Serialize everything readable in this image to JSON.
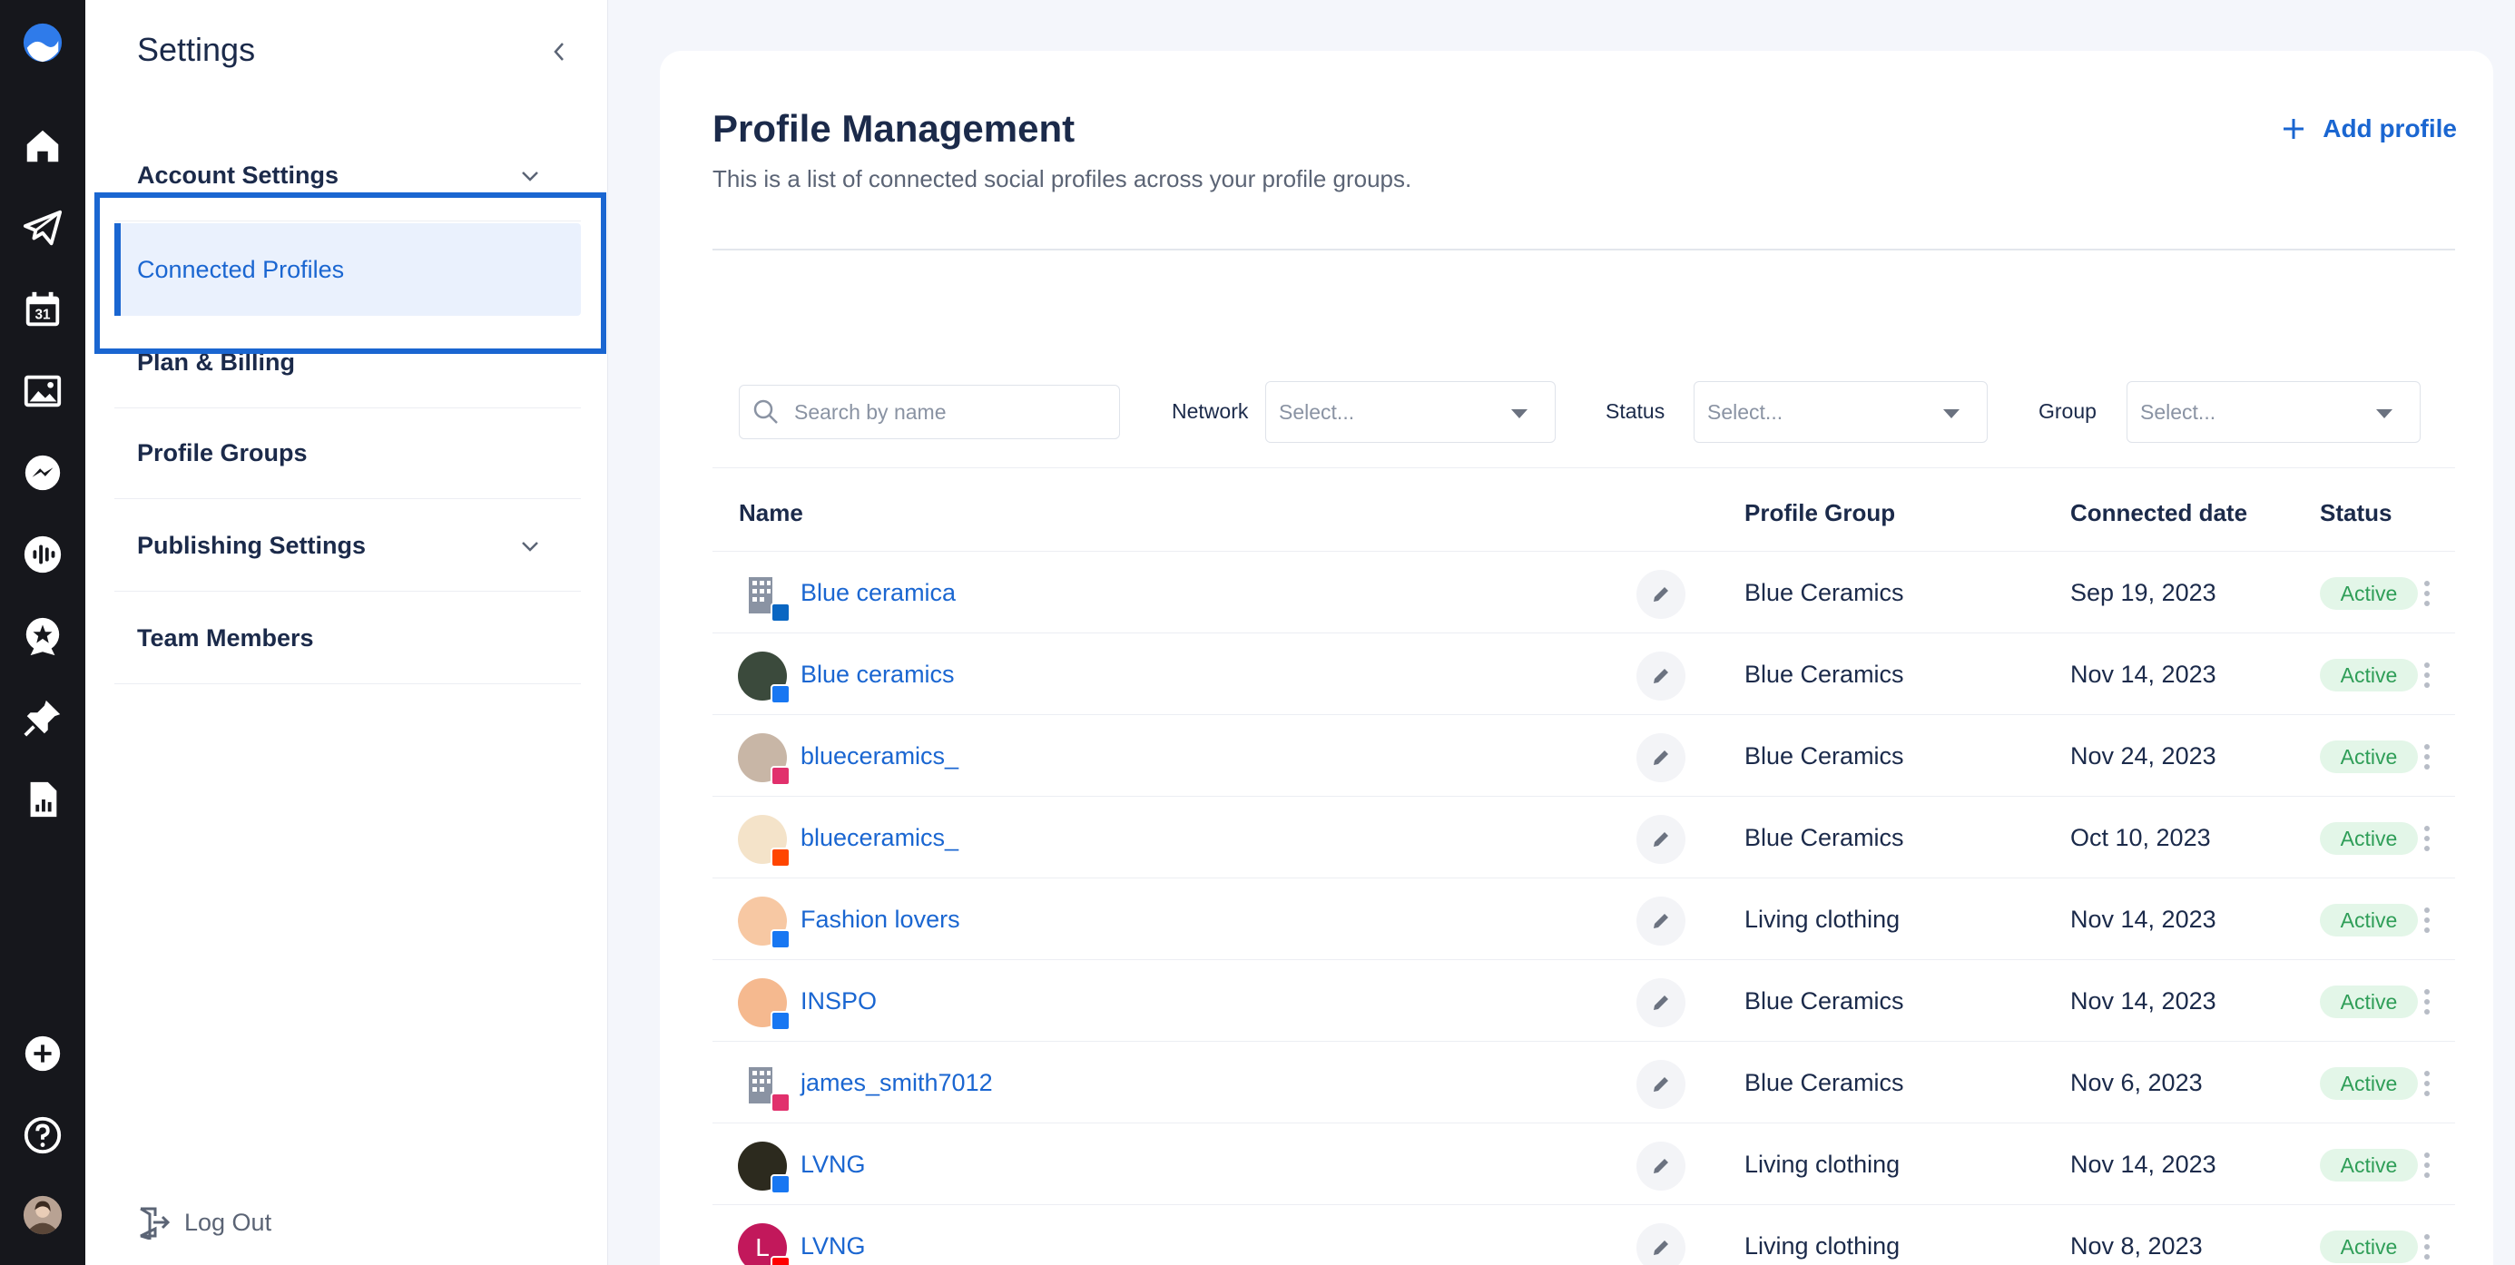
{
  "rail": {
    "icons": [
      "logo-icon",
      "home-icon",
      "paper-plane-icon",
      "calendar-icon",
      "image-icon",
      "messenger-icon",
      "audio-waves-icon",
      "star-badge-icon",
      "pin-icon",
      "report-icon",
      "plus-circle-icon",
      "help-icon",
      "user-avatar"
    ],
    "calendar_day": "31"
  },
  "sidebar": {
    "title": "Settings",
    "items": [
      {
        "label": "Account Settings"
      },
      {
        "label": "Connected Profiles"
      },
      {
        "label": "Plan & Billing"
      },
      {
        "label": "Profile Groups"
      },
      {
        "label": "Publishing Settings"
      },
      {
        "label": "Team Members"
      }
    ],
    "logout_label": "Log Out"
  },
  "main": {
    "title": "Profile Management",
    "subtitle": "This is a list of connected social profiles across your profile groups.",
    "add_profile_label": "Add profile",
    "filters": {
      "search_placeholder": "Search by name",
      "network_label": "Network",
      "network_value": "Select...",
      "status_label": "Status",
      "status_value": "Select...",
      "group_label": "Group",
      "group_value": "Select..."
    },
    "columns": {
      "name": "Name",
      "profile_group": "Profile Group",
      "connected_date": "Connected date",
      "status": "Status"
    },
    "rows": [
      {
        "name": "Blue ceramica",
        "network": "linkedin",
        "group": "Blue Ceramics",
        "date": "Sep 19, 2023",
        "status": "Active"
      },
      {
        "name": "Blue ceramics",
        "network": "facebook",
        "group": "Blue Ceramics",
        "date": "Nov 14, 2023",
        "status": "Active"
      },
      {
        "name": "blueceramics_",
        "network": "instagram",
        "group": "Blue Ceramics",
        "date": "Nov 24, 2023",
        "status": "Active"
      },
      {
        "name": "blueceramics_",
        "network": "reddit",
        "group": "Blue Ceramics",
        "date": "Oct 10, 2023",
        "status": "Active"
      },
      {
        "name": "Fashion lovers",
        "network": "facebook",
        "group": "Living clothing",
        "date": "Nov 14, 2023",
        "status": "Active"
      },
      {
        "name": "INSPO",
        "network": "facebook",
        "group": "Blue Ceramics",
        "date": "Nov 14, 2023",
        "status": "Active"
      },
      {
        "name": "james_smith7012",
        "network": "instagram",
        "group": "Blue Ceramics",
        "date": "Nov 6, 2023",
        "status": "Active"
      },
      {
        "name": "LVNG",
        "network": "facebook",
        "group": "Living clothing",
        "date": "Nov 14, 2023",
        "status": "Active"
      },
      {
        "name": "LVNG",
        "network": "youtube",
        "group": "Living clothing",
        "date": "Nov 8, 2023",
        "status": "Active",
        "avatar_letter": "L"
      }
    ]
  },
  "colors": {
    "accent": "#1a66d1",
    "rail_bg": "#16171c",
    "active_bg": "#eaf1fd",
    "status_bg": "#e3f6e8",
    "status_text": "#2f9e58"
  }
}
